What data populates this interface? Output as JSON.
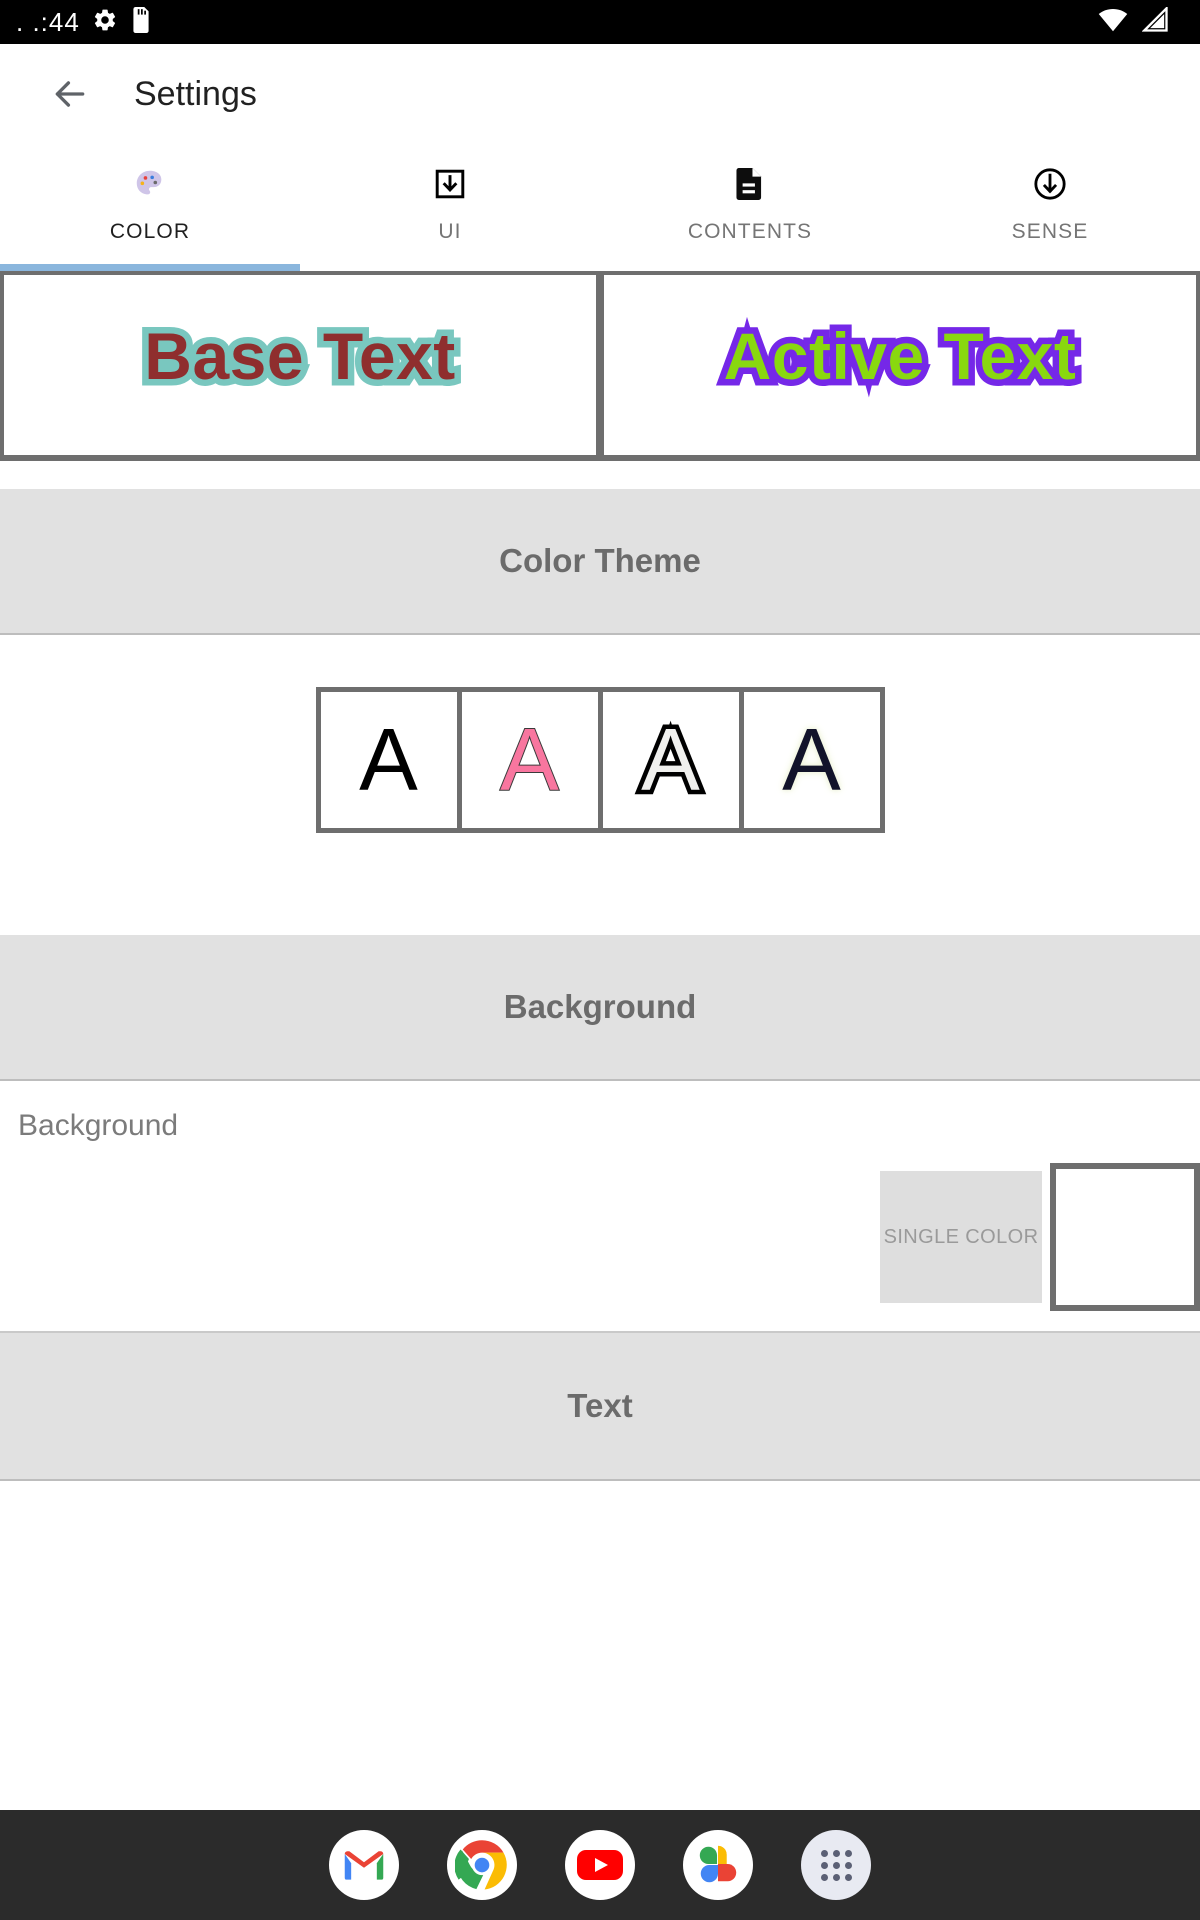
{
  "status_bar": {
    "clock": ". .:44",
    "icons": [
      "gear-icon",
      "sd-card-icon",
      "wifi-icon",
      "cellular-signal-icon"
    ]
  },
  "app_bar": {
    "back_label": "back-arrow",
    "title": "Settings"
  },
  "tabs": {
    "active_index": 0,
    "items": [
      {
        "label": "COLOR",
        "icon": "palette-icon"
      },
      {
        "label": "UI",
        "icon": "download-box-icon"
      },
      {
        "label": "CONTENTS",
        "icon": "document-icon"
      },
      {
        "label": "SENSE",
        "icon": "circle-down-arrow-icon"
      }
    ],
    "indicator_color": "#8ab6dd"
  },
  "preview": {
    "base": {
      "text": "Base Text",
      "fill_color": "#8f2e2e",
      "outline_color": "#79c7bf"
    },
    "active": {
      "text": "Active Text",
      "fill_color": "#89d80f",
      "outline_color": "#7528e8"
    }
  },
  "sections": {
    "color_theme": {
      "title": "Color Theme",
      "swatches": [
        {
          "letter": "A",
          "style": "plain",
          "fill": "#000000",
          "outline": ""
        },
        {
          "letter": "A",
          "style": "pink",
          "fill": "#f8769f",
          "outline": "#3a3a3a"
        },
        {
          "letter": "A",
          "style": "outline",
          "fill": "#f0f0ee",
          "outline": "#000000"
        },
        {
          "letter": "A",
          "style": "glow",
          "fill": "#12132a",
          "outline": "#eef3d8"
        }
      ]
    },
    "background": {
      "title": "Background",
      "row_label": "Background",
      "mode_chip": "SINGLE COLOR",
      "color_value": "#ffffff"
    },
    "text": {
      "title": "Text"
    }
  },
  "dock": {
    "items": [
      {
        "name": "gmail-icon"
      },
      {
        "name": "chrome-icon"
      },
      {
        "name": "youtube-icon"
      },
      {
        "name": "photos-icon"
      },
      {
        "name": "app-drawer-icon"
      }
    ]
  }
}
